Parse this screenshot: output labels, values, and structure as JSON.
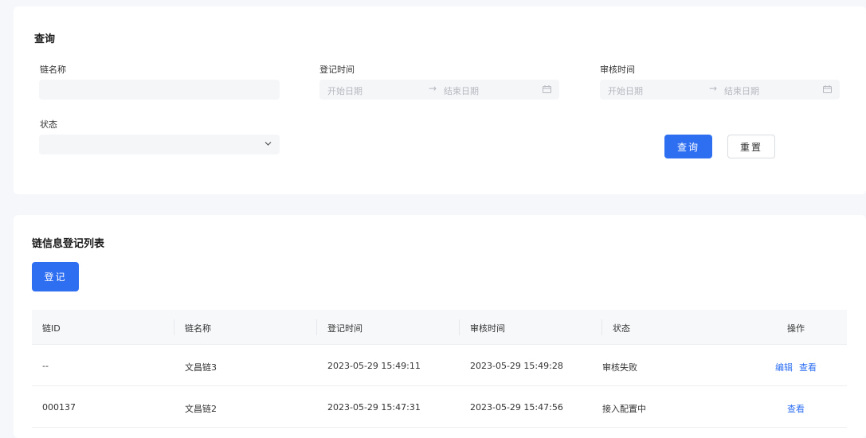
{
  "query": {
    "title": "查询",
    "chain_name": {
      "label": "链名称",
      "value": ""
    },
    "register_time": {
      "label": "登记时间",
      "start_placeholder": "开始日期",
      "end_placeholder": "结束日期"
    },
    "audit_time": {
      "label": "审核时间",
      "start_placeholder": "开始日期",
      "end_placeholder": "结束日期"
    },
    "status": {
      "label": "状态",
      "value": ""
    },
    "search_label": "查询",
    "reset_label": "重置"
  },
  "list": {
    "title": "链信息登记列表",
    "register_label": "登记",
    "columns": [
      "链ID",
      "链名称",
      "登记时间",
      "审核时间",
      "状态",
      "操作"
    ],
    "rows": [
      {
        "id": "--",
        "name": "文昌链3",
        "register_time": "2023-05-29 15:49:11",
        "audit_time": "2023-05-29 15:49:28",
        "status": "审核失败",
        "actions": [
          "编辑",
          "查看"
        ]
      },
      {
        "id": "000137",
        "name": "文昌链2",
        "register_time": "2023-05-29 15:47:31",
        "audit_time": "2023-05-29 15:47:56",
        "status": "接入配置中",
        "actions": [
          "查看"
        ]
      }
    ]
  },
  "colors": {
    "primary": "#2e6ff2",
    "page_bg": "#f5f7fb",
    "field_bg": "#f5f6f8"
  },
  "icons": {
    "date": "calendar-icon",
    "select": "chevron-down-icon",
    "range": "arrow-right-icon"
  }
}
